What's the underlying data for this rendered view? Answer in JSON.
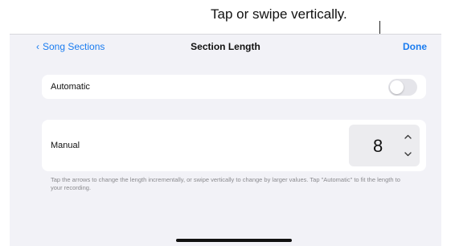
{
  "callout": {
    "text": "Tap or swipe vertically."
  },
  "navbar": {
    "back_label": "Song Sections",
    "title": "Section Length",
    "done_label": "Done"
  },
  "automatic": {
    "label": "Automatic",
    "toggle_on": false
  },
  "manual": {
    "label": "Manual",
    "value": "8"
  },
  "footnote": "Tap the arrows to change the length incrementally, or swipe vertically to change by larger values. Tap \"Automatic\" to fit the length to your recording.",
  "colors": {
    "accent": "#1a7cf0",
    "background": "#f2f2f7",
    "card": "#ffffff",
    "secondary_text": "#8a8a8e"
  },
  "icons": {
    "back": "chevron-left-icon",
    "increment": "chevron-up-icon",
    "decrement": "chevron-down-icon"
  }
}
